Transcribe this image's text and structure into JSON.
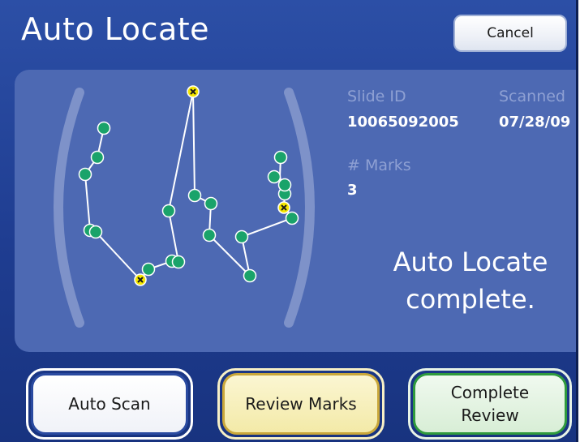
{
  "header": {
    "title": "Auto Locate",
    "cancel_label": "Cancel"
  },
  "slide_info": {
    "slide_id_label": "Slide ID",
    "slide_id_value": "10065092005",
    "scanned_label": "Scanned",
    "scanned_value": "07/28/09",
    "marks_label": "# Marks",
    "marks_value": "3"
  },
  "status_message": {
    "line1": "Auto Locate",
    "line2": "complete."
  },
  "footer": {
    "auto_scan_label": "Auto Scan",
    "review_marks_label": "Review Marks",
    "complete_review_line1": "Complete",
    "complete_review_line2": "Review"
  },
  "colors": {
    "background": "#2c4fa6",
    "panel": "#4d69b3",
    "path_point": "#1aa36a",
    "mark_point": "#f4e600",
    "review_accent": "#c9a73a",
    "complete_accent": "#2f9a3d"
  }
}
